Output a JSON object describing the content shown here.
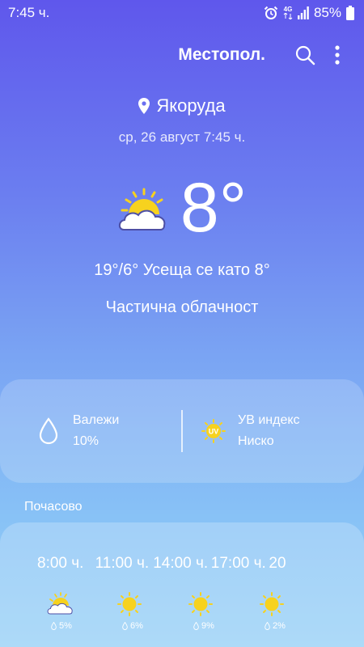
{
  "status_bar": {
    "time": "7:45 ч.",
    "network": "4G",
    "battery": "85%"
  },
  "app_bar": {
    "title": "Местопол."
  },
  "location": {
    "name": "Якоруда",
    "datetime": "ср, 26 август 7:45 ч."
  },
  "current": {
    "temperature": "8°",
    "hilo_feels": "19°/6° Усеща се като 8°",
    "condition": "Частична облачност",
    "icon": "partly-cloudy-icon"
  },
  "details": {
    "precip_label": "Валежи",
    "precip_value": "10%",
    "uv_label": "УВ индекс",
    "uv_value": "Ниско",
    "uv_badge": "UV"
  },
  "hourly": {
    "title": "Почасово",
    "items": [
      {
        "time": "8:00 ч.",
        "icon": "partly-cloudy-icon",
        "precip": "5%"
      },
      {
        "time": "11:00 ч.",
        "icon": "sun-icon",
        "precip": "6%"
      },
      {
        "time": "14:00 ч.",
        "icon": "sun-icon",
        "precip": "9%"
      },
      {
        "time": "17:00 ч.",
        "icon": "sun-icon",
        "precip": "2%"
      },
      {
        "time": "20"
      }
    ]
  },
  "colors": {
    "sun": "#f7d21e",
    "gradient_top": "#5f57ec",
    "gradient_bottom": "#96d0f7"
  }
}
